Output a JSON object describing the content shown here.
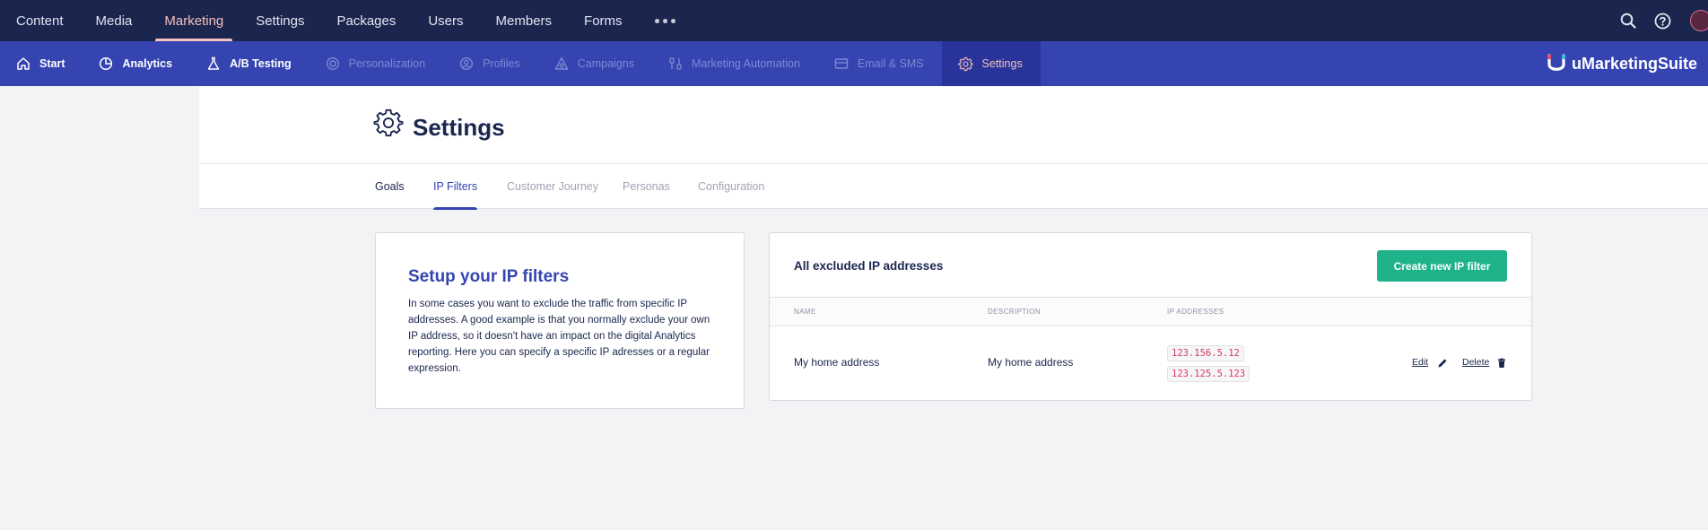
{
  "top_nav": {
    "items": [
      {
        "label": "Content"
      },
      {
        "label": "Media"
      },
      {
        "label": "Marketing",
        "active": true
      },
      {
        "label": "Settings"
      },
      {
        "label": "Packages"
      },
      {
        "label": "Users"
      },
      {
        "label": "Members"
      },
      {
        "label": "Forms"
      }
    ],
    "icons": [
      "search-icon",
      "help-icon",
      "user-avatar"
    ]
  },
  "sub_nav": {
    "items": [
      {
        "label": "Start",
        "icon": "home-icon"
      },
      {
        "label": "Analytics",
        "icon": "pie-chart-icon"
      },
      {
        "label": "A/B Testing",
        "icon": "flask-icon"
      },
      {
        "label": "Personalization",
        "icon": "target-icon",
        "disabled": true
      },
      {
        "label": "Profiles",
        "icon": "profile-icon",
        "disabled": true
      },
      {
        "label": "Campaigns",
        "icon": "campaign-icon",
        "disabled": true
      },
      {
        "label": "Marketing Automation",
        "icon": "automation-icon",
        "disabled": true
      },
      {
        "label": "Email & SMS",
        "icon": "email-icon",
        "disabled": true
      },
      {
        "label": "Settings",
        "icon": "gear-icon",
        "active": true
      }
    ],
    "brand": "uMarketingSuite"
  },
  "page": {
    "title": "Settings",
    "tabs": [
      {
        "label": "Goals"
      },
      {
        "label": "IP Filters",
        "active": true
      },
      {
        "label": "Customer Journey"
      },
      {
        "label": "Personas"
      },
      {
        "label": "Configuration"
      }
    ]
  },
  "setup": {
    "title": "Setup your IP filters",
    "body": "In some cases you want to exclude the traffic from specific IP addresses. A good example is that you normally exclude your own IP address, so it doesn't have an impact on the digital Analytics reporting. Here you can specify a specific IP adresses or a regular expression."
  },
  "table": {
    "title": "All excluded IP addresses",
    "create_label": "Create new IP filter",
    "columns": [
      "NAME",
      "DESCRIPTION",
      "IP ADDRESSES"
    ],
    "rows": [
      {
        "name": "My home address",
        "description": "My home address",
        "ips": [
          "123.156.5.12",
          "123.125.5.123"
        ],
        "edit_label": "Edit",
        "delete_label": "Delete"
      }
    ]
  },
  "colors": {
    "top_bar": "#1b264f",
    "sub_bar": "#3544b1",
    "accent": "#f5c1bc",
    "create_button": "#1fb38c",
    "ip_text": "#d63b5a"
  }
}
